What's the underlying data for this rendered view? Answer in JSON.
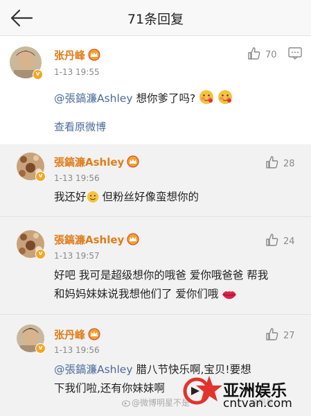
{
  "header": {
    "title": "71条回复",
    "back_icon": "back-arrow-icon"
  },
  "main_comment": {
    "username": "张丹峰",
    "timestamp": "1-13 19:55",
    "likes": "70",
    "mention": "@張鎬濂Ashley",
    "text": " 想你爹了吗?",
    "view_original": "查看原微博"
  },
  "replies": [
    {
      "username": "張鎬濂Ashley",
      "timestamp": "1-13 19:56",
      "likes": "28",
      "line1_a": "我还好",
      "line1_b": " 但粉丝好像蛮想你的"
    },
    {
      "username": "張鎬濂Ashley",
      "timestamp": "1-13 19:57",
      "likes": "24",
      "line1": "好吧 我可是超级想你的哦爸 爱你哦爸爸 帮我",
      "line2": "和妈妈妹妹说我想他们了 爱你们哦"
    },
    {
      "username": "张丹峰",
      "timestamp": "1-13 19:56",
      "likes": "27",
      "mention": "@張鎬濂Ashley",
      "line1": " 腊八节快乐啊,宝贝!要想",
      "line2": "下我们啦,还有你妹妹啊"
    }
  ],
  "watermark": {
    "weibo_user": "@微博明星不是",
    "weibo_user2": "@明星",
    "site_name": "亚洲娱乐",
    "site_url": "cntvan.com"
  },
  "colors": {
    "username": "#e07d1a",
    "mention": "#4a6a9a",
    "vip_badge": "#f5a623",
    "reply_bg": "#f2f2f2"
  }
}
